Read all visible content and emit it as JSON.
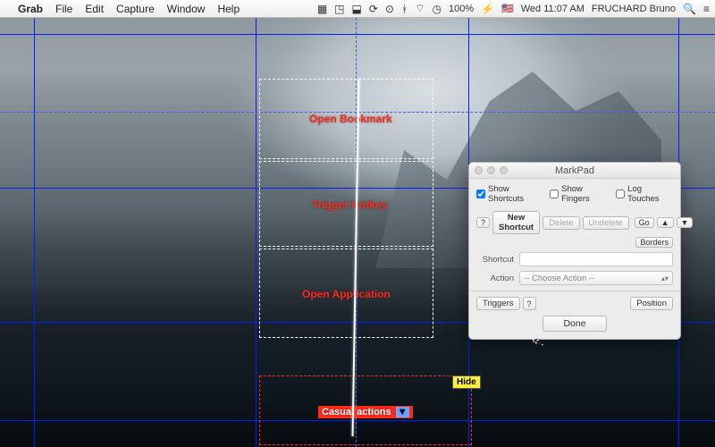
{
  "menubar": {
    "apple_glyph": "",
    "app_name": "Grab",
    "menus": [
      "File",
      "Edit",
      "Capture",
      "Window",
      "Help"
    ],
    "right_items": {
      "battery": "100%",
      "battery_icon": "⚡",
      "flag": "🇺🇸",
      "clock": "Wed 11:07 AM",
      "user": "FRUCHARD Bruno"
    }
  },
  "regions": {
    "r1": "Open Bookmark",
    "r2": "Trigger Hotkey",
    "r3": "Open Application",
    "category": "Casual actions",
    "hide": "Hide"
  },
  "markpad": {
    "title": "MarkPad",
    "chk_shortcuts": "Show Shortcuts",
    "chk_fingers": "Show Fingers",
    "chk_log": "Log Touches",
    "help": "?",
    "new_shortcut": "New Shortcut",
    "delete": "Delete",
    "undelete": "Undelete",
    "go": "Go",
    "borders": "Borders",
    "lbl_shortcut": "Shortcut",
    "lbl_action": "Action",
    "action_placeholder": "-- Choose Action --",
    "triggers": "Triggers",
    "position": "Position",
    "done": "Done"
  }
}
